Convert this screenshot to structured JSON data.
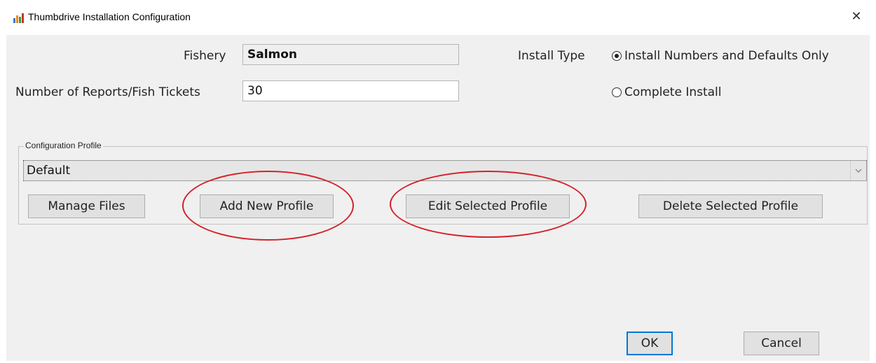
{
  "window": {
    "title": "Thumbdrive Installation Configuration",
    "icon": "thumbdrive-app-icon",
    "close_glyph": "✕"
  },
  "form": {
    "fishery_label": "Fishery",
    "fishery_value": "Salmon",
    "reports_label": "Number of Reports/Fish Tickets",
    "reports_value": "30",
    "install_type_label": "Install Type",
    "install_options": [
      {
        "label": "Install Numbers and Defaults Only",
        "selected": true
      },
      {
        "label": "Complete Install",
        "selected": false
      }
    ]
  },
  "profile": {
    "group_label": "Configuration Profile",
    "selected": "Default",
    "dropdown_icon": "chevron-down-icon",
    "buttons": {
      "manage": "Manage Files",
      "add": "Add New Profile",
      "edit": "Edit Selected Profile",
      "delete": "Delete Selected Profile"
    }
  },
  "footer": {
    "ok": "OK",
    "cancel": "Cancel"
  },
  "colors": {
    "annotation": "#d42128",
    "dialog_bg": "#f0f0f0",
    "focus_border": "#0078d7"
  }
}
